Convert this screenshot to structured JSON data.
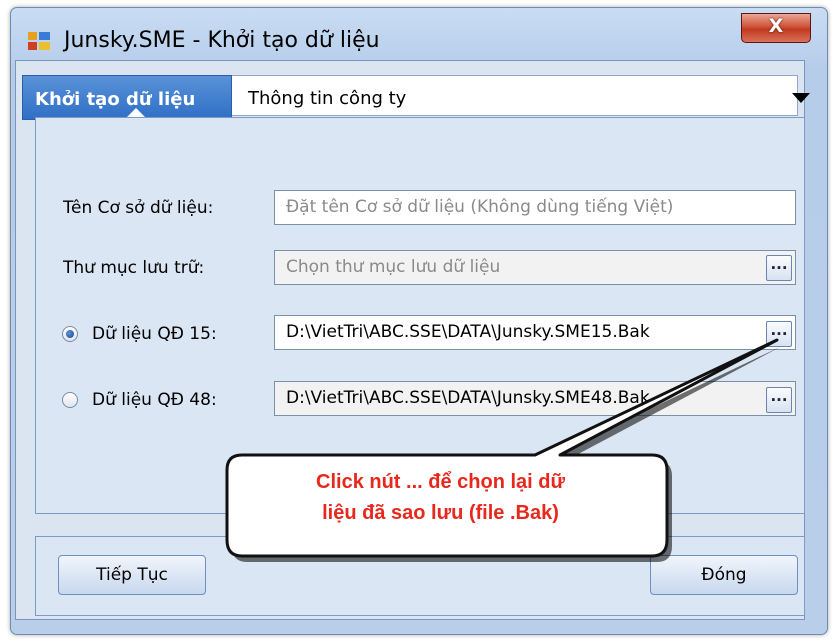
{
  "window": {
    "title": "Junsky.SME - Khởi tạo dữ liệu",
    "close_label": "X"
  },
  "tabs": [
    {
      "label": "Khởi tạo dữ liệu",
      "active": true
    },
    {
      "label": "Thông tin công ty",
      "active": false
    }
  ],
  "form": {
    "db_name_label": "Tên Cơ sở dữ liệu:",
    "db_name_placeholder": "Đặt tên Cơ sở dữ liệu (Không dùng tiếng Việt)",
    "folder_label": "Thư mục lưu trữ:",
    "folder_placeholder": "Chọn thư mục lưu dữ liệu",
    "qd15_label": "Dữ liệu QĐ 15:",
    "qd15_path": "D:\\VietTri\\ABC.SSE\\DATA\\Junsky.SME15.Bak",
    "qd48_label": "Dữ liệu QĐ 48:",
    "qd48_path": "D:\\VietTri\\ABC.SSE\\DATA\\Junsky.SME48.Bak",
    "browse_label": "...",
    "selected_option": "qd15"
  },
  "buttons": {
    "continue_label": "Tiếp Tục",
    "close_label": "Đóng"
  },
  "callout": {
    "line1": "Click nút ... để chọn lại dữ",
    "line2": "liệu đã sao lưu (file .Bak)",
    "color": "#e8281c"
  }
}
